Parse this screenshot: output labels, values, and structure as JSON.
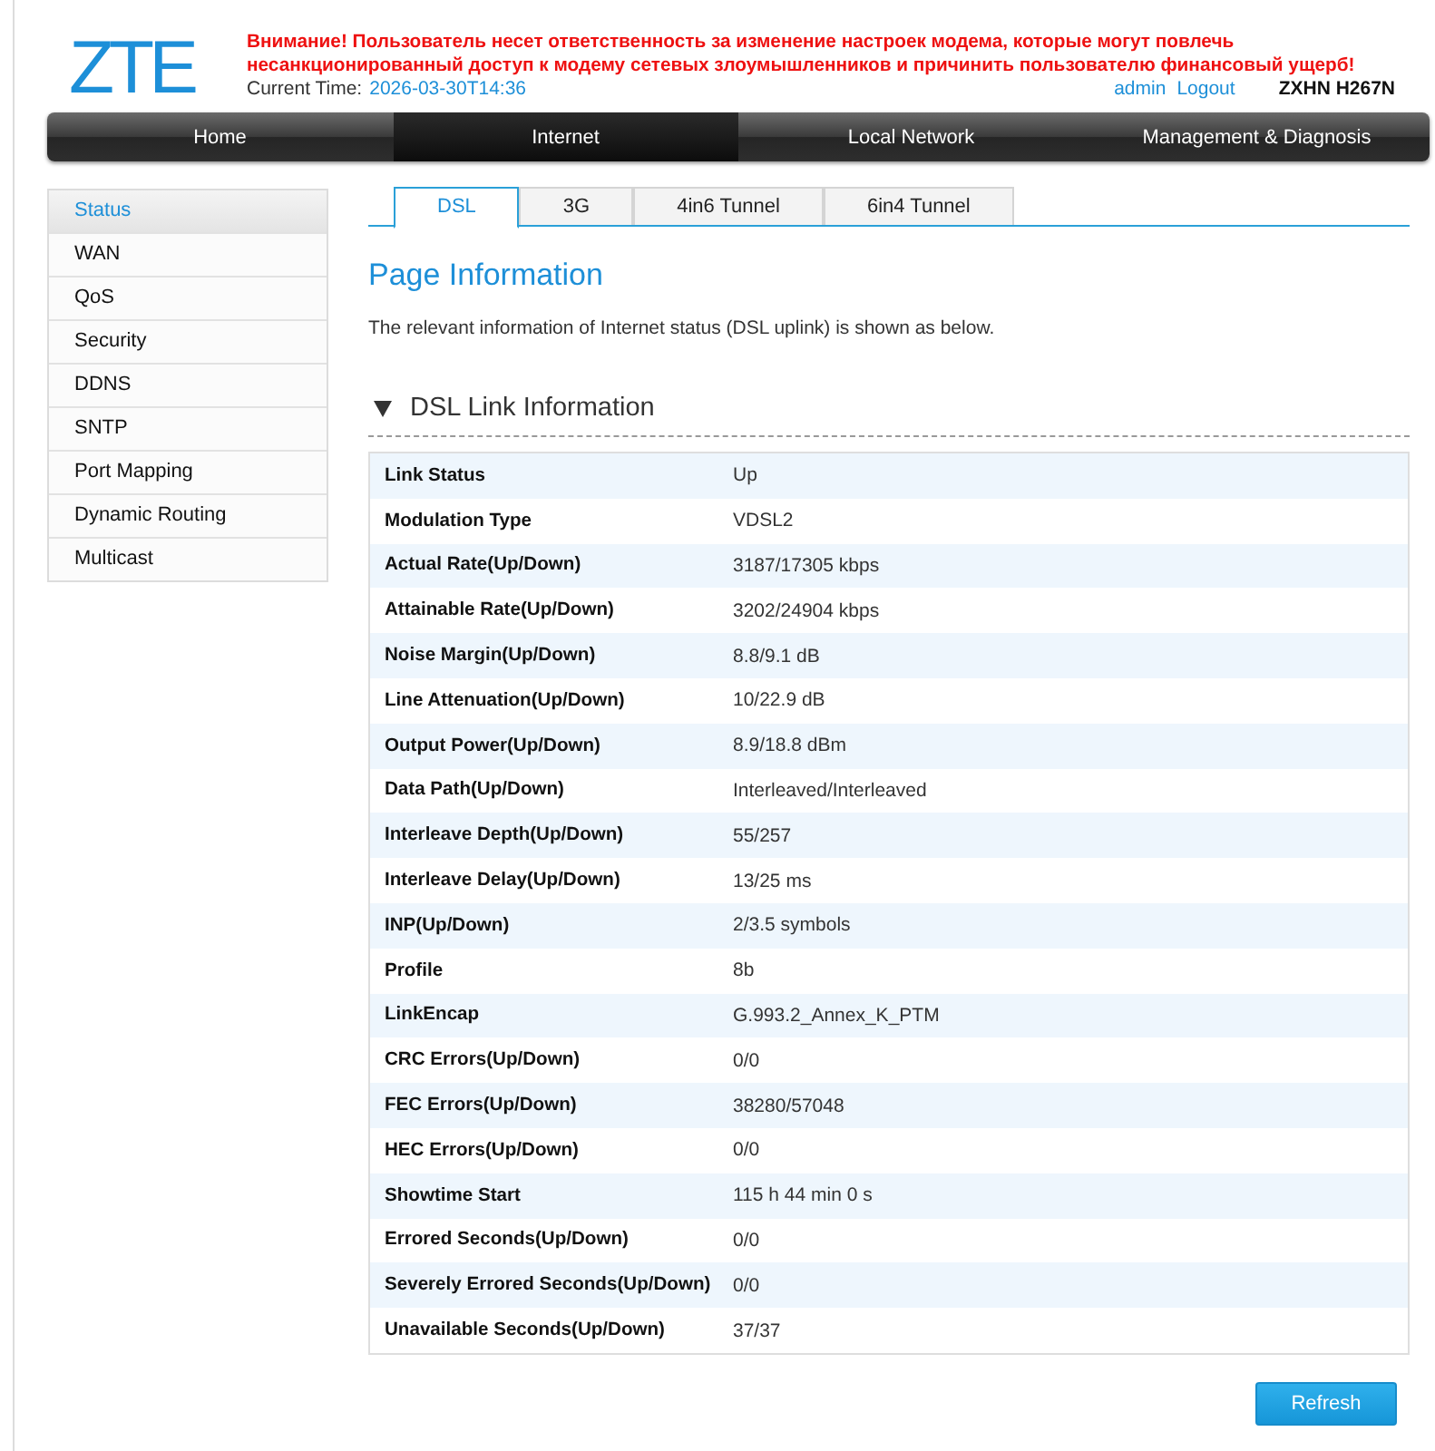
{
  "header": {
    "logo": "ZTE",
    "warning": "Внимание! Пользователь несет ответственность за изменение настроек модема, которые могут повлечь несанкционированный доступ к модему сетевых злоумышленников и причинить пользователю финансовый ущерб!",
    "current_time_label": "Current Time:",
    "current_time": "2026-03-30T14:36",
    "user_links": [
      "admin",
      "Logout"
    ],
    "model": "ZXHN H267N"
  },
  "nav": [
    {
      "label": "Home",
      "selected": false
    },
    {
      "label": "Internet",
      "selected": true
    },
    {
      "label": "Local Network",
      "selected": false
    },
    {
      "label": "Management & Diagnosis",
      "selected": false
    }
  ],
  "sidebar": [
    {
      "label": "Status",
      "selected": true
    },
    {
      "label": "WAN",
      "selected": false
    },
    {
      "label": "QoS",
      "selected": false
    },
    {
      "label": "Security",
      "selected": false
    },
    {
      "label": "DDNS",
      "selected": false
    },
    {
      "label": "SNTP",
      "selected": false
    },
    {
      "label": "Port Mapping",
      "selected": false
    },
    {
      "label": "Dynamic Routing",
      "selected": false
    },
    {
      "label": "Multicast",
      "selected": false
    }
  ],
  "tabs": [
    {
      "label": "DSL",
      "selected": true
    },
    {
      "label": "3G",
      "selected": false
    },
    {
      "label": "4in6 Tunnel",
      "selected": false
    },
    {
      "label": "6in4 Tunnel",
      "selected": false
    }
  ],
  "page_title": "Page Information",
  "description": "The relevant information of Internet status (DSL uplink) is shown as below.",
  "section": {
    "title": "DSL Link Information",
    "expanded": true,
    "rows": [
      {
        "label": "Link Status",
        "value": "Up"
      },
      {
        "label": "Modulation Type",
        "value": "VDSL2"
      },
      {
        "label": "Actual Rate(Up/Down)",
        "value": "3187/17305 kbps"
      },
      {
        "label": "Attainable Rate(Up/Down)",
        "value": "3202/24904 kbps"
      },
      {
        "label": "Noise Margin(Up/Down)",
        "value": "8.8/9.1 dB"
      },
      {
        "label": "Line Attenuation(Up/Down)",
        "value": "10/22.9 dB"
      },
      {
        "label": "Output Power(Up/Down)",
        "value": "8.9/18.8 dBm"
      },
      {
        "label": "Data Path(Up/Down)",
        "value": "Interleaved/Interleaved"
      },
      {
        "label": "Interleave Depth(Up/Down)",
        "value": "55/257"
      },
      {
        "label": "Interleave Delay(Up/Down)",
        "value": "13/25 ms"
      },
      {
        "label": "INP(Up/Down)",
        "value": "2/3.5 symbols"
      },
      {
        "label": "Profile",
        "value": "8b"
      },
      {
        "label": "LinkEncap",
        "value": "G.993.2_Annex_K_PTM"
      },
      {
        "label": "CRC Errors(Up/Down)",
        "value": "0/0"
      },
      {
        "label": "FEC Errors(Up/Down)",
        "value": "38280/57048"
      },
      {
        "label": "HEC Errors(Up/Down)",
        "value": "0/0"
      },
      {
        "label": "Showtime Start",
        "value": "115 h 44 min 0 s"
      },
      {
        "label": "Errored Seconds(Up/Down)",
        "value": "0/0"
      },
      {
        "label": "Severely Errored Seconds(Up/Down)",
        "value": "0/0"
      },
      {
        "label": "Unavailable Seconds(Up/Down)",
        "value": "37/37"
      }
    ]
  },
  "buttons": [
    {
      "label": "Refresh"
    }
  ]
}
